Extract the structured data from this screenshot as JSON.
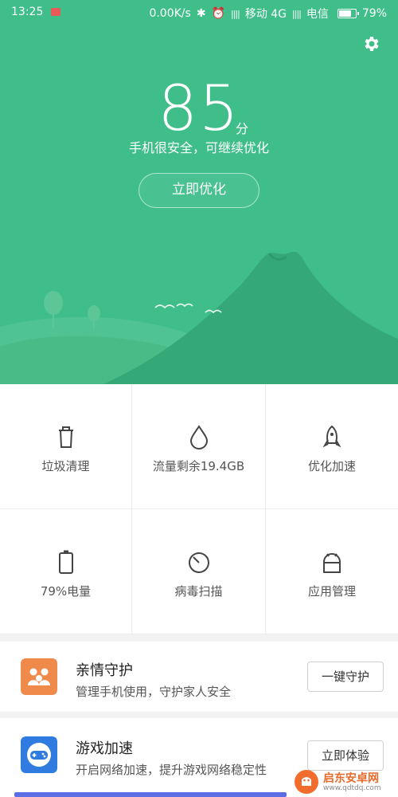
{
  "status_bar": {
    "time": "13:25",
    "net_speed": "0.00K/s",
    "carrier1": "移动 4G",
    "carrier2": "电信",
    "battery_text": "79%",
    "battery_level": 0.79
  },
  "hero": {
    "score": "85",
    "score_unit": "分",
    "subtitle": "手机很安全，可继续优化",
    "optimize_label": "立即优化",
    "settings_icon": "gear-icon",
    "background_color": "#3fbe8a"
  },
  "tools": [
    {
      "label": "垃圾清理",
      "icon": "trash-icon"
    },
    {
      "label": "流量剩余19.4GB",
      "icon": "drop-icon"
    },
    {
      "label": "优化加速",
      "icon": "rocket-icon"
    },
    {
      "label": "79%电量",
      "icon": "battery-icon"
    },
    {
      "label": "病毒扫描",
      "icon": "scan-icon"
    },
    {
      "label": "应用管理",
      "icon": "android-icon"
    }
  ],
  "cards": [
    {
      "title": "亲情守护",
      "desc": "管理手机使用，守护家人安全",
      "action": "一键守护",
      "icon": "family-icon",
      "icon_color": "#f08a4b"
    },
    {
      "title": "游戏加速",
      "desc": "开启网络加速，提升游戏网络稳定性",
      "action": "立即体验",
      "icon": "gamepad-icon",
      "icon_color": "#2f7be0"
    }
  ],
  "watermark": {
    "brand": "启东安卓网",
    "site": "www.qdtdq.com"
  }
}
